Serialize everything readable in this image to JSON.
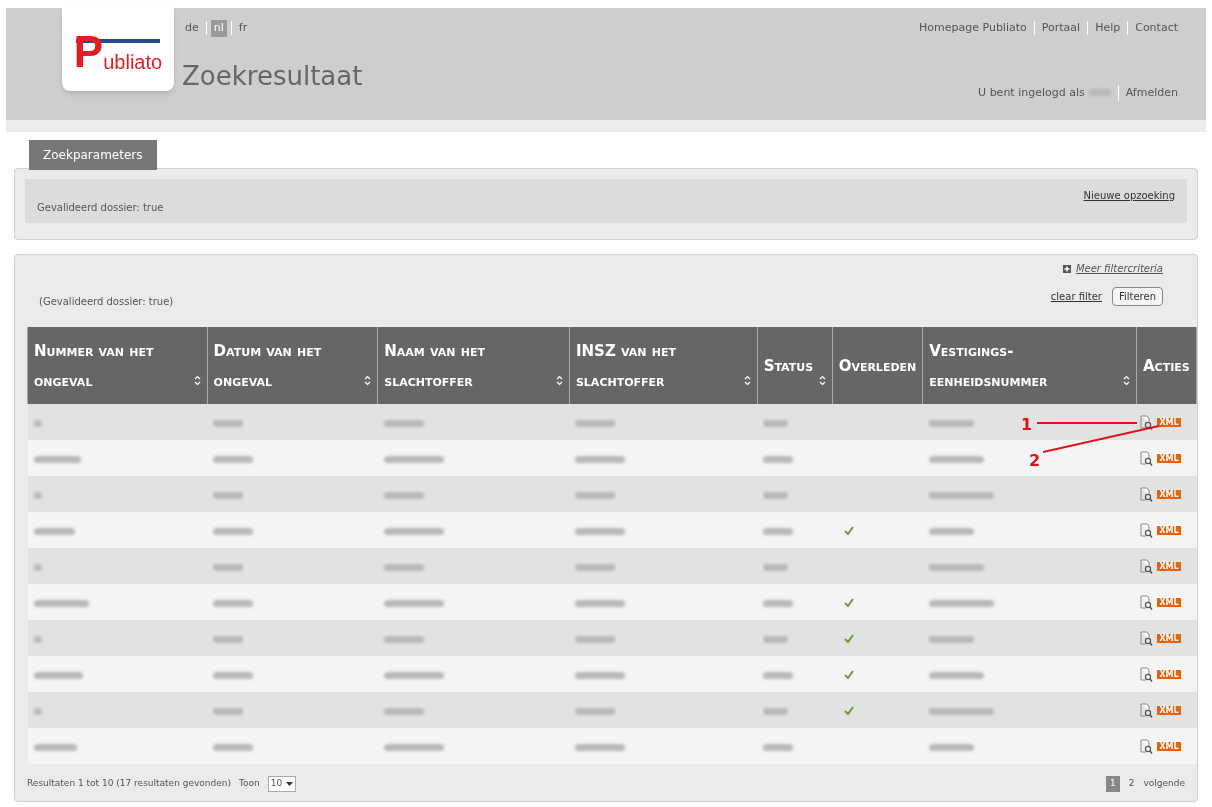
{
  "header": {
    "logo": {
      "initial": "P",
      "rest": "ubliato"
    },
    "languages": [
      {
        "label": "de",
        "selected": false
      },
      {
        "label": "nl",
        "selected": true
      },
      {
        "label": "fr",
        "selected": false
      }
    ],
    "title": "Zoekresultaat",
    "top_links": [
      "Homepage Publiato",
      "Portaal",
      "Help",
      "Contact"
    ],
    "login_text": "U bent ingelogd als",
    "logout": "Afmelden"
  },
  "search_parameters": {
    "tab": "Zoekparameters",
    "summary": "Gevalideerd dossier: true",
    "new_search": "Nieuwe opzoeking"
  },
  "results": {
    "more_filters": "Meer filtercriteria",
    "filter_summary": "(Gevalideerd dossier: true)",
    "clear_filter": "clear filter",
    "filter_button": "Filteren",
    "table": {
      "columns": [
        {
          "label": "Nummer van het ongeval",
          "sortable": true
        },
        {
          "label": "Datum van het ongeval",
          "sortable": true
        },
        {
          "label": "Naam van het slachtoffer",
          "sortable": true
        },
        {
          "label": "INSZ van het slachtoffer",
          "sortable": true
        },
        {
          "label": "Status",
          "sortable": true
        },
        {
          "label": "Overleden",
          "sortable": false
        },
        {
          "label": "Vestigings- eenheidsnummer",
          "sortable": true
        },
        {
          "label": "Acties",
          "sortable": false
        }
      ],
      "rows": [
        {
          "deceased": false,
          "action_label": "XML"
        },
        {
          "deceased": false,
          "action_label": "XML"
        },
        {
          "deceased": false,
          "action_label": "XML"
        },
        {
          "deceased": true,
          "action_label": "XML"
        },
        {
          "deceased": false,
          "action_label": "XML"
        },
        {
          "deceased": true,
          "action_label": "XML"
        },
        {
          "deceased": true,
          "action_label": "XML"
        },
        {
          "deceased": true,
          "action_label": "XML"
        },
        {
          "deceased": true,
          "action_label": "XML"
        },
        {
          "deceased": false,
          "action_label": "XML"
        }
      ]
    },
    "annotations": [
      "1",
      "2"
    ],
    "footer": {
      "summary": "Resultaten 1 tot 10 (17 resultaten gevonden)",
      "show_label": "Toon",
      "page_size": "10",
      "pages": [
        {
          "label": "1",
          "selected": true
        },
        {
          "label": "2",
          "selected": false
        }
      ],
      "next": "volgende"
    }
  }
}
